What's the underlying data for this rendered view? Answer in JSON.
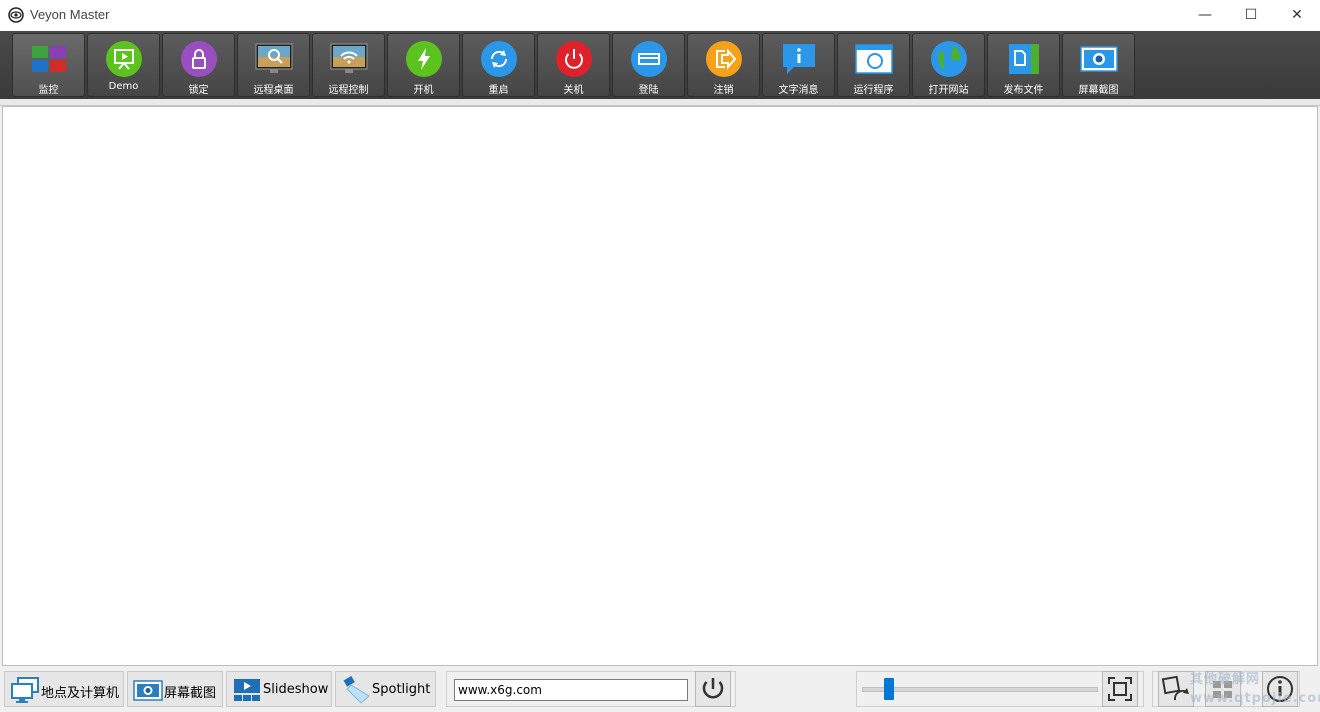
{
  "window": {
    "title": "Veyon Master",
    "minimize": "—",
    "maximize": "☐",
    "close": "✕"
  },
  "toolbar": {
    "items": [
      {
        "label": "监控",
        "icon": "monitor-grid-icon"
      },
      {
        "label": "Demo",
        "icon": "presentation-icon"
      },
      {
        "label": "锁定",
        "icon": "lock-icon"
      },
      {
        "label": "远程桌面",
        "icon": "remote-view-icon"
      },
      {
        "label": "远程控制",
        "icon": "remote-control-icon"
      },
      {
        "label": "开机",
        "icon": "power-on-icon"
      },
      {
        "label": "重启",
        "icon": "reboot-icon"
      },
      {
        "label": "关机",
        "icon": "power-off-icon"
      },
      {
        "label": "登陆",
        "icon": "login-icon"
      },
      {
        "label": "注销",
        "icon": "logout-icon"
      },
      {
        "label": "文字消息",
        "icon": "message-icon"
      },
      {
        "label": "运行程序",
        "icon": "run-program-icon"
      },
      {
        "label": "打开网站",
        "icon": "open-website-icon"
      },
      {
        "label": "发布文件",
        "icon": "transfer-file-icon"
      },
      {
        "label": "屏幕截图",
        "icon": "screenshot-icon"
      }
    ]
  },
  "bottombar": {
    "locations_label": "地点及计算机",
    "screenshot_label": "屏幕截图",
    "slideshow_label": "Slideshow",
    "spotlight_label": "Spotlight",
    "address_value": "www.x6g.com"
  },
  "watermark": {
    "line1": "其他破解网",
    "line2": "www.qtpojie.com"
  },
  "colors": {
    "toolbar_bg": "#404040",
    "accent": "#0078d7"
  }
}
